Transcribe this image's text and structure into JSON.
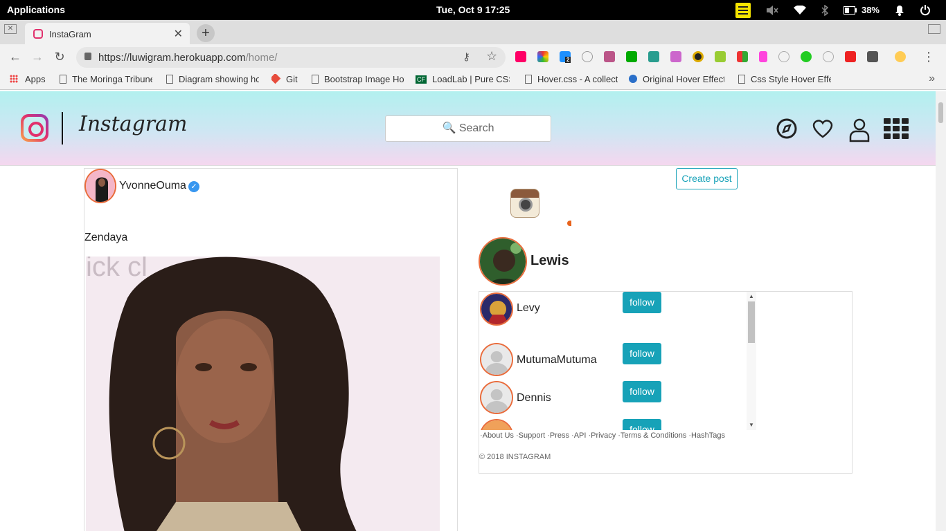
{
  "system_bar": {
    "applications": "Applications",
    "datetime": "Tue, Oct  9   17:25",
    "battery": "38%",
    "icons": [
      "sticky-notes-icon",
      "volume-muted-icon",
      "wifi-icon",
      "bluetooth-icon",
      "battery-icon",
      "bell-icon",
      "power-icon"
    ]
  },
  "browser": {
    "tab_title": "InstaGram",
    "url_host": "https://luwigram.herokuapp.com",
    "url_path": "/home/",
    "bookmarks": [
      "Apps",
      "The Moringa Tribune",
      "Diagram showing how",
      "Git",
      "Bootstrap Image Hov",
      "LoadLab | Pure CSS",
      "Hover.css - A collect",
      "Original Hover Effect",
      "Css Style Hover Effe"
    ],
    "bookmark_cf": "CF",
    "extension_badge": "2"
  },
  "header": {
    "brand": "Instagram",
    "search_placeholder": "🔍 Search",
    "icons": [
      "compass-icon",
      "heart-icon",
      "user-icon",
      "apps-grid-icon"
    ]
  },
  "post": {
    "username": "YvonneOuma",
    "verified": "✓",
    "caption": "Zendaya"
  },
  "sidebar": {
    "create_post": "Create post",
    "profile_name": "Lewis",
    "suggestions": [
      {
        "name": "Levy",
        "action": "follow"
      },
      {
        "name": "MutumaMutuma",
        "action": "follow"
      },
      {
        "name": "Dennis",
        "action": "follow"
      },
      {
        "name": "",
        "action": "follow"
      }
    ],
    "footer_links": "·About Us ·Support ·Press ·API ·Privacy ·Terms & Conditions ·HashTags",
    "copyright": "© 2018 INSTAGRAM"
  },
  "colors": {
    "accent": "#17a2b8",
    "header_top": "#b2f0ef",
    "header_bottom": "#f5d7ef",
    "verified": "#3897f0"
  }
}
